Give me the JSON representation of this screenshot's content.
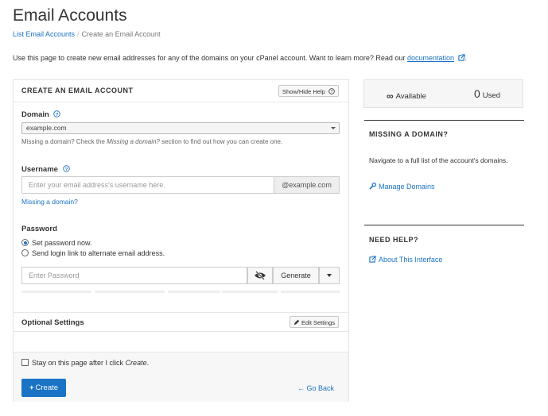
{
  "page": {
    "title": "Email Accounts"
  },
  "breadcrumb": {
    "parent": "List Email Accounts",
    "separator": "/",
    "current": "Create an Email Account"
  },
  "intro": {
    "text": "Use this page to create new email addresses for any of the domains on your cPanel account. Want to learn more? Read our ",
    "link": "documentation",
    "end": "."
  },
  "form": {
    "title": "CREATE AN EMAIL ACCOUNT",
    "toggle_help": "Show/Hide Help",
    "domain": {
      "label": "Domain",
      "value": "example.com",
      "help_prefix": "Missing a domain? Check the ",
      "help_italic": "Missing a domain?",
      "help_suffix": " section to find out how you can create one."
    },
    "username": {
      "label": "Username",
      "placeholder": "Enter your email address's username here.",
      "suffix": "@example.com",
      "missing_link": "Missing a domain?"
    },
    "password": {
      "label": "Password",
      "options": [
        "Set password now.",
        "Send login link to alternate email address."
      ],
      "selected": 0,
      "placeholder": "Enter Password",
      "generate": "Generate"
    },
    "optional": {
      "label": "Optional Settings",
      "edit": "Edit Settings"
    },
    "stay": {
      "prefix": "Stay on this page after I click ",
      "italic": "Create",
      "suffix": "."
    },
    "create": "Create",
    "go_back": "Go Back"
  },
  "stats": {
    "available_symbol": "∞",
    "available_label": "Available",
    "used_count": "0",
    "used_label": "Used"
  },
  "sidebar": {
    "missing_title": "MISSING A DOMAIN?",
    "missing_text": "Navigate to a full list of the account's domains.",
    "manage_link": "Manage Domains",
    "help_title": "NEED HELP?",
    "about_link": "About This Interface"
  },
  "colors": {
    "link": "#1a73c4",
    "primary": "#1a73c4"
  }
}
